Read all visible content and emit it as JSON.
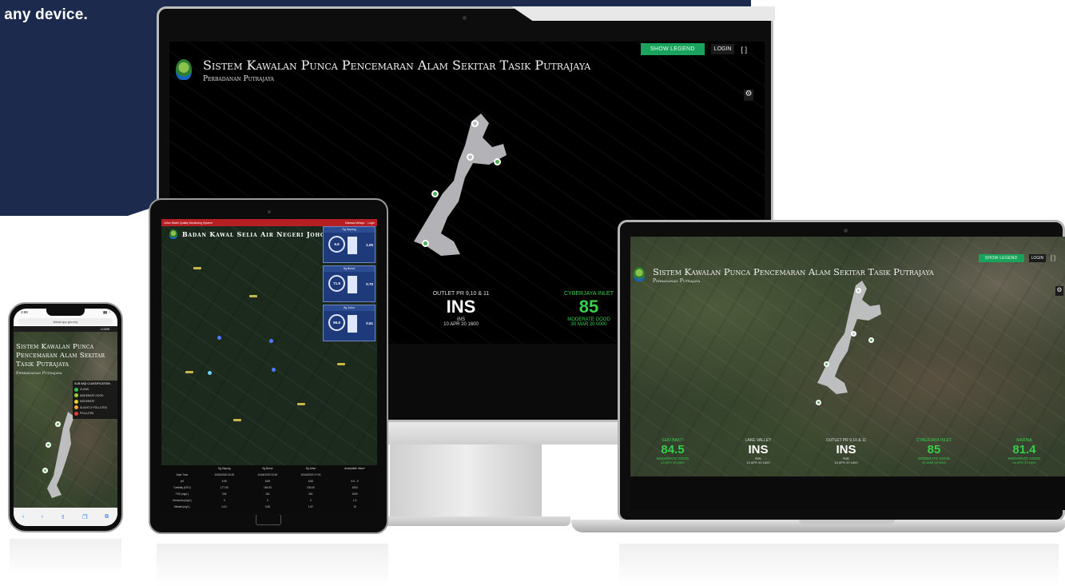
{
  "banner": {
    "tagline": "n any device."
  },
  "desktop": {
    "show_legend": "SHOW LEGEND",
    "login": "LOGIN",
    "fullscreen": "[ ]",
    "title": "Sistem Kawalan Punca Pencemaran Alam Sekitar Tasik Putrajaya",
    "subtitle": "Perbadanan Putrajaya",
    "stats": [
      {
        "name": "OUTLET PR 9,10 & 11",
        "value": "INS",
        "status": "INS",
        "date": "10 APR 20 1600"
      },
      {
        "name": "CYBERJAYA INLET",
        "value": "85",
        "status": "MODERATE GOOD",
        "date": "30 MAR 20 0000"
      }
    ]
  },
  "laptop": {
    "show_legend": "SHOW LEGEND",
    "login": "LOGIN",
    "title": "Sistem Kawalan Punca Pencemaran Alam Sekitar Tasik Putrajaya",
    "subtitle": "Perbadanan Putrajaya",
    "stats": [
      {
        "name": "SERI BAKTI",
        "value": "84.5",
        "status": "MODERATE GOOD",
        "date": "10 APR 20 1600"
      },
      {
        "name": "LAKE VALLEY",
        "value": "INS",
        "status": "INS",
        "date": "10 APR 20 1600"
      },
      {
        "name": "OUTLET PR 9,10 & 11",
        "value": "INS",
        "status": "INS",
        "date": "10 APR 20 1600"
      },
      {
        "name": "CYBERJAYA INLET",
        "value": "85",
        "status": "MODERATE GOOD",
        "date": "30 MAR 20 0000"
      },
      {
        "name": "MARINA",
        "value": "81.4",
        "status": "MODERATE GOOD",
        "date": "08 APR 20 1600"
      }
    ]
  },
  "tablet": {
    "topbar_left": "Johor Water Quality Monitoring System",
    "topbar_right1": "Bahasa Melayu",
    "topbar_right2": "Login",
    "title": "Badan Kawal Selia Air Negeri Johor",
    "panels": [
      {
        "title": "Sg Sayong",
        "gauge": "6.9",
        "value": "1.00"
      },
      {
        "title": "Sg Benut",
        "gauge": "71.8",
        "value": "0.70"
      },
      {
        "title": "Sg Johor",
        "gauge": "86.8",
        "value": "0.51"
      }
    ],
    "table": {
      "headers": [
        "",
        "Sg Sayong",
        "Sg Benut",
        "Sg Johor",
        "Acceptable Value*"
      ],
      "rows": [
        [
          "Date Time",
          "10/04/2020 00:15",
          "10/04/2020 23:00",
          "10/04/2020 17:00",
          ""
        ],
        [
          "pH",
          "6.90",
          "6.89",
          "6.83",
          "6.5 - 9"
        ],
        [
          "Turbidity (NTU)",
          "177.50",
          "154.93",
          "230.00",
          "1000"
        ],
        [
          "TSS (mg/L)",
          "226",
          "161",
          "261",
          "1000"
        ],
        [
          "Ammonia (mg/L)",
          "0",
          "0",
          "0",
          "1.5"
        ],
        [
          "Nitrate (mg/L)",
          "0.01",
          "0.08",
          "1.87",
          "10"
        ]
      ]
    }
  },
  "phone": {
    "time": "3:58",
    "url": "iktiraf.spp.gov.my",
    "login": "LOGIN",
    "title": "Sistem Kawalan Punca Pencemaran Alam Sekitar Tasik Putrajaya",
    "subtitle": "Perbadanan Putrajaya",
    "legend_title": "SUB-WQI CLASSIFICATION",
    "legend_items": [
      {
        "label": "CLEAN",
        "color": "#3dbb4a"
      },
      {
        "label": "MODERATE GOOD",
        "color": "#9ccc3c"
      },
      {
        "label": "MODERATE",
        "color": "#e6d22e"
      },
      {
        "label": "SLIGHTLY POLLUTED",
        "color": "#f1a93a"
      },
      {
        "label": "POLLUTED",
        "color": "#e53935"
      }
    ]
  }
}
